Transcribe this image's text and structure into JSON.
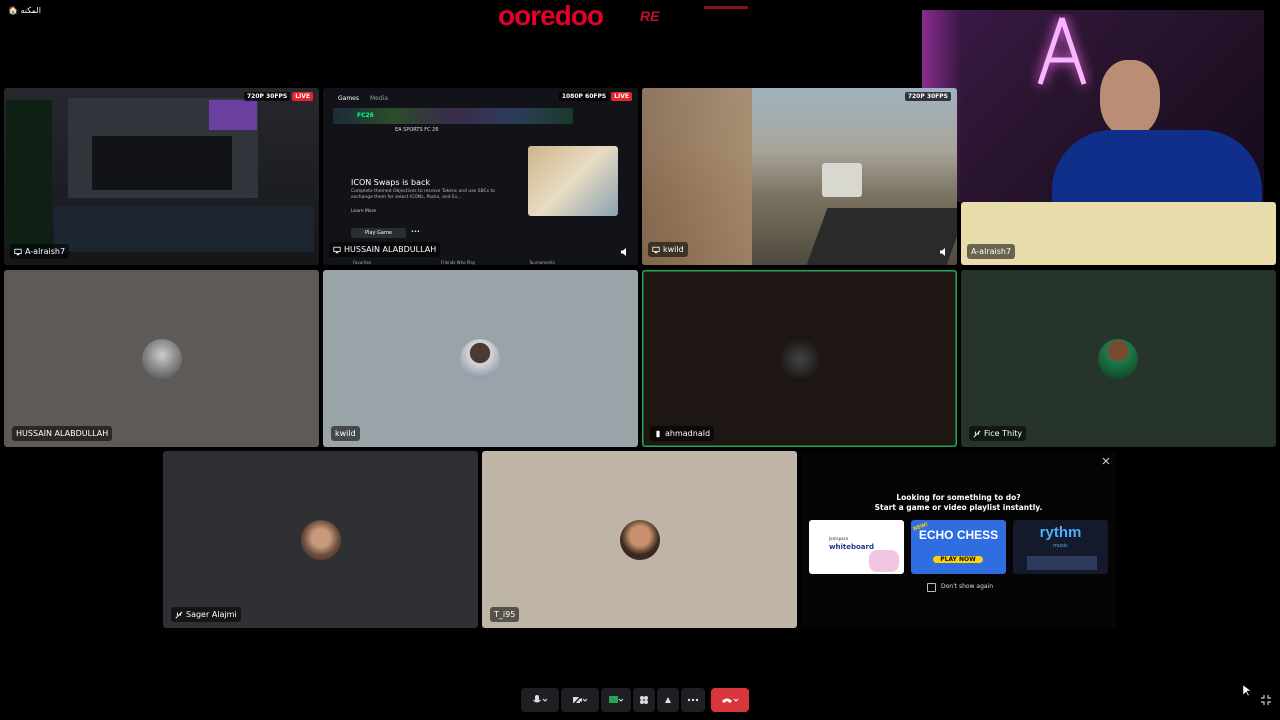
{
  "top_left": {
    "text": "🏠 المكنه"
  },
  "sponsor": {
    "brand": "ooredoo",
    "badge": "RE"
  },
  "tiles": [
    {
      "name": "A-alraish7",
      "kind": "screen",
      "res": "720P 30FPS",
      "live": "LIVE"
    },
    {
      "name": "HUSSAIN ALABDULLAH",
      "kind": "screen",
      "res": "1080P 60FPS",
      "live": "LIVE",
      "screen": {
        "tab_games": "Games",
        "tab_media": "Media",
        "app_badge": "FC26",
        "app_title": "EA SPORTS FC 26",
        "headline": "ICON Swaps is back",
        "body": "Complete themed Objectives to receive Tokens and use SBCs to exchange them for select ICONs, Packs, and Ev...",
        "learn_more": "Learn More",
        "play": "Play Game",
        "more": "•••",
        "foot1": "Favorites",
        "foot2": "Friends Who Play",
        "foot3": "Tournaments"
      }
    },
    {
      "name": "kwild",
      "kind": "screen",
      "res": "720P 30FPS"
    },
    {
      "name": "A-alraish7",
      "kind": "empty"
    },
    {
      "name": "HUSSAIN ALABDULLAH",
      "kind": "avatar"
    },
    {
      "name": "kwild",
      "kind": "avatar"
    },
    {
      "name": "ahmadnald",
      "kind": "avatar"
    },
    {
      "name": "Fice Thity",
      "kind": "avatar"
    },
    {
      "name": "Sager Alajmi",
      "kind": "avatar"
    },
    {
      "name": "T_i95",
      "kind": "avatar"
    }
  ],
  "activity_panel": {
    "title": "Looking for something to do?",
    "subtitle": "Start a game or video playlist instantly.",
    "cards": [
      {
        "title": "whiteboard",
        "sub": "Jamspace"
      },
      {
        "title": "ECHO CHESS",
        "sub": "PLAY NOW",
        "tag": "NEW!"
      },
      {
        "title": "rythm",
        "sub": "music"
      }
    ],
    "checkbox_label": "Don't show again"
  },
  "colors": {
    "accent_green": "#23a55a",
    "live_red": "#e4252d",
    "hangup_red": "#da373c",
    "ooredoo_red": "#e4002b"
  }
}
